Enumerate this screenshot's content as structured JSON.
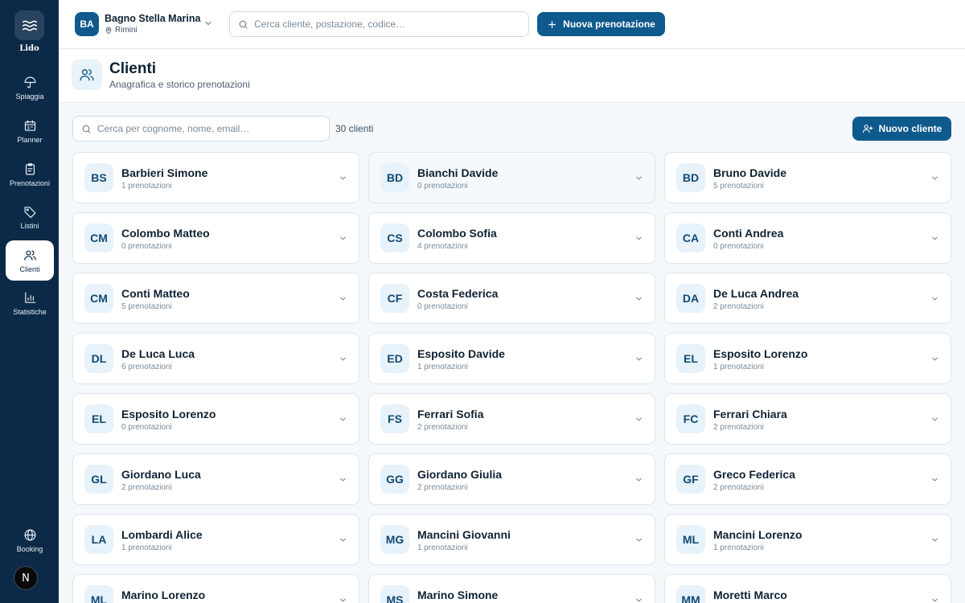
{
  "sidebar": {
    "logo": "Lido",
    "items": [
      {
        "label": "Spiaggia",
        "icon": "umbrella-icon"
      },
      {
        "label": "Planner",
        "icon": "calendar-icon"
      },
      {
        "label": "Prenotazioni",
        "icon": "clipboard-icon"
      },
      {
        "label": "Listini",
        "icon": "tag-icon"
      },
      {
        "label": "Clienti",
        "icon": "users-icon",
        "active": true
      },
      {
        "label": "Statistiche",
        "icon": "bar-chart-icon"
      }
    ],
    "booking_label": "Booking",
    "avatar_initial": "N"
  },
  "topbar": {
    "business_initials": "BA",
    "business_name": "Bagno Stella Marina",
    "business_location": "Rimini",
    "search_placeholder": "Cerca cliente, postazione, codice…",
    "new_booking_label": "Nuova prenotazione"
  },
  "page": {
    "title": "Clienti",
    "subtitle": "Anagrafica e storico prenotazioni",
    "filter_placeholder": "Cerca per cognome, nome, email…",
    "count_label": "30 clienti",
    "new_client_label": "Nuovo cliente"
  },
  "clients": [
    {
      "initials": "BS",
      "name": "Barbieri Simone",
      "bookings": "1 prenotazioni"
    },
    {
      "initials": "BD",
      "name": "Bianchi Davide",
      "bookings": "0 prenotazioni"
    },
    {
      "initials": "BD",
      "name": "Bruno Davide",
      "bookings": "5 prenotazioni"
    },
    {
      "initials": "CM",
      "name": "Colombo Matteo",
      "bookings": "0 prenotazioni"
    },
    {
      "initials": "CS",
      "name": "Colombo Sofia",
      "bookings": "4 prenotazioni"
    },
    {
      "initials": "CA",
      "name": "Conti Andrea",
      "bookings": "0 prenotazioni"
    },
    {
      "initials": "CM",
      "name": "Conti Matteo",
      "bookings": "5 prenotazioni"
    },
    {
      "initials": "CF",
      "name": "Costa Federica",
      "bookings": "0 prenotazioni"
    },
    {
      "initials": "DA",
      "name": "De Luca Andrea",
      "bookings": "2 prenotazioni"
    },
    {
      "initials": "DL",
      "name": "De Luca Luca",
      "bookings": "6 prenotazioni"
    },
    {
      "initials": "ED",
      "name": "Esposito Davide",
      "bookings": "1 prenotazioni"
    },
    {
      "initials": "EL",
      "name": "Esposito Lorenzo",
      "bookings": "1 prenotazioni"
    },
    {
      "initials": "EL",
      "name": "Esposito Lorenzo",
      "bookings": "0 prenotazioni"
    },
    {
      "initials": "FS",
      "name": "Ferrari Sofia",
      "bookings": "2 prenotazioni"
    },
    {
      "initials": "FC",
      "name": "Ferrari Chiara",
      "bookings": "2 prenotazioni"
    },
    {
      "initials": "GL",
      "name": "Giordano Luca",
      "bookings": "2 prenotazioni"
    },
    {
      "initials": "GG",
      "name": "Giordano Giulia",
      "bookings": "2 prenotazioni"
    },
    {
      "initials": "GF",
      "name": "Greco Federica",
      "bookings": "2 prenotazioni"
    },
    {
      "initials": "LA",
      "name": "Lombardi Alice",
      "bookings": "1 prenotazioni"
    },
    {
      "initials": "MG",
      "name": "Mancini Giovanni",
      "bookings": "1 prenotazioni"
    },
    {
      "initials": "ML",
      "name": "Mancini Lorenzo",
      "bookings": "1 prenotazioni"
    },
    {
      "initials": "ML",
      "name": "Marino Lorenzo",
      "bookings": ""
    },
    {
      "initials": "MS",
      "name": "Marino Simone",
      "bookings": ""
    },
    {
      "initials": "MM",
      "name": "Moretti Marco",
      "bookings": ""
    }
  ],
  "colors": {
    "sidebar": "#0c2a47",
    "primary": "#0f5a8c",
    "background": "#f4f8fb"
  }
}
